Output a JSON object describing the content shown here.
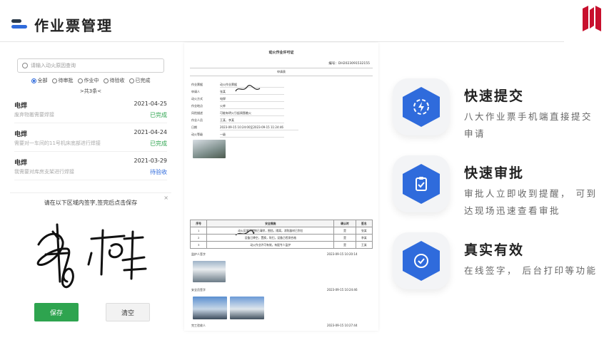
{
  "page": {
    "title": "作业票管理"
  },
  "search": {
    "placeholder": "请输入动火原因查询"
  },
  "filters": [
    {
      "label": "全部",
      "selected": true
    },
    {
      "label": "待审批",
      "selected": false
    },
    {
      "label": "作业中",
      "selected": false
    },
    {
      "label": "待验收",
      "selected": false
    },
    {
      "label": "已完成",
      "selected": false
    }
  ],
  "list_count": ">共3条<",
  "list": [
    {
      "name": "电焊",
      "date": "2021-04-25",
      "desc": "废弃物搬需要焊接",
      "status": "已完成",
      "status_color": "#2ea44f"
    },
    {
      "name": "电焊",
      "date": "2021-04-24",
      "desc": "需要对一车间的11号机床底部进行焊接",
      "status": "已完成",
      "status_color": "#2ea44f"
    },
    {
      "name": "电焊",
      "date": "2021-03-29",
      "desc": "我需要对库房支架进行焊接",
      "status": "待验收",
      "status_color": "#2f6bdc"
    }
  ],
  "signature": {
    "instruction": "请在以下区域内签字,签完后点击保存",
    "close": "×",
    "save": "保存",
    "clear": "清空"
  },
  "document": {
    "title": "动火作业许可证",
    "number": "编号：DH2023091532155",
    "section": "申请表",
    "fields": [
      {
        "label": "作业票据",
        "value": "动火作业票据"
      },
      {
        "label": "申请人",
        "value": "张某"
      },
      {
        "label": "动火方式",
        "value": "电焊"
      },
      {
        "label": "作业地点",
        "value": "火库"
      },
      {
        "label": "风险描述",
        "value": "可能有明火引起周围着火"
      },
      {
        "label": "作业人员",
        "value": "王某、李某"
      },
      {
        "label": "日期",
        "value": "2023-09-15 10:24:00至2023-09-15 11:24:46"
      },
      {
        "label": "动火等级",
        "value": "一级"
      }
    ],
    "table_headers": [
      "序号",
      "安全措施",
      "确认时",
      "签名"
    ],
    "table_rows": [
      [
        "1",
        "动火区域可燃物已清除，围挡，隔离，消防器材已到位",
        "是",
        "张某"
      ],
      [
        "2",
        "设备已降空，置换，吹扫，设备已检测合格",
        "是",
        "李某"
      ],
      [
        "3",
        "动火作业许可有效，有配专人监护",
        "是",
        "王某"
      ]
    ],
    "foot_rows": [
      {
        "label": "监护人签字",
        "time": "2023-09-15 10:20:14"
      },
      {
        "label": "安全员签字",
        "time": "2023-09-15 10:24:46"
      },
      {
        "label": "完工验收人",
        "time": "2023-09-15 10:27:44"
      }
    ]
  },
  "features": [
    {
      "title": "快速提交",
      "desc": "八大作业票手机端直接提交申请",
      "icon": "lightning-icon"
    },
    {
      "title": "快速审批",
      "desc": "审批人立即收到提醒， 可到达现场迅速查看审批",
      "icon": "clipboard-check-icon"
    },
    {
      "title": "真实有效",
      "desc": "在线签字， 后台打印等功能",
      "icon": "check-circle-icon"
    }
  ]
}
